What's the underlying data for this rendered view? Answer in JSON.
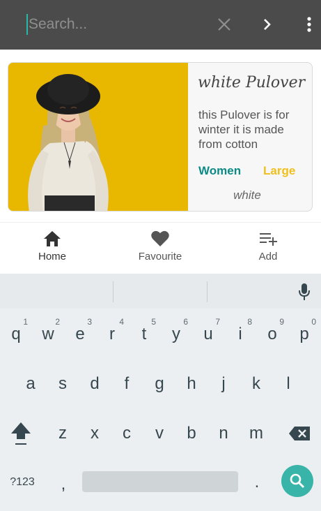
{
  "search": {
    "placeholder": "Search...",
    "clear_icon": "close-icon",
    "submit_icon": "chevron-right-icon",
    "menu_icon": "more-vertical-icon"
  },
  "product": {
    "title": "white Pulover",
    "description": "this Pulover is for winter it is made from cotton",
    "gender": "Women",
    "size": "Large",
    "color": "white",
    "accent_gender": "#0b8a86",
    "accent_size": "#f0bf1a",
    "photo_background": "#e8b800"
  },
  "nav": {
    "home": "Home",
    "favourite": "Favourite",
    "add": "Add"
  },
  "keyboard": {
    "row1": [
      "q",
      "w",
      "e",
      "r",
      "t",
      "y",
      "u",
      "i",
      "o",
      "p"
    ],
    "row1_hints": [
      "1",
      "2",
      "3",
      "4",
      "5",
      "6",
      "7",
      "8",
      "9",
      "0"
    ],
    "row2": [
      "a",
      "s",
      "d",
      "f",
      "g",
      "h",
      "j",
      "k",
      "l"
    ],
    "row3": [
      "z",
      "x",
      "c",
      "v",
      "b",
      "n",
      "m"
    ],
    "symbols_label": "?123",
    "comma": ",",
    "period": "."
  },
  "colors": {
    "topbar": "#4b4b4b",
    "accent": "#39b4a8",
    "keyboard_bg": "#eceff1"
  }
}
